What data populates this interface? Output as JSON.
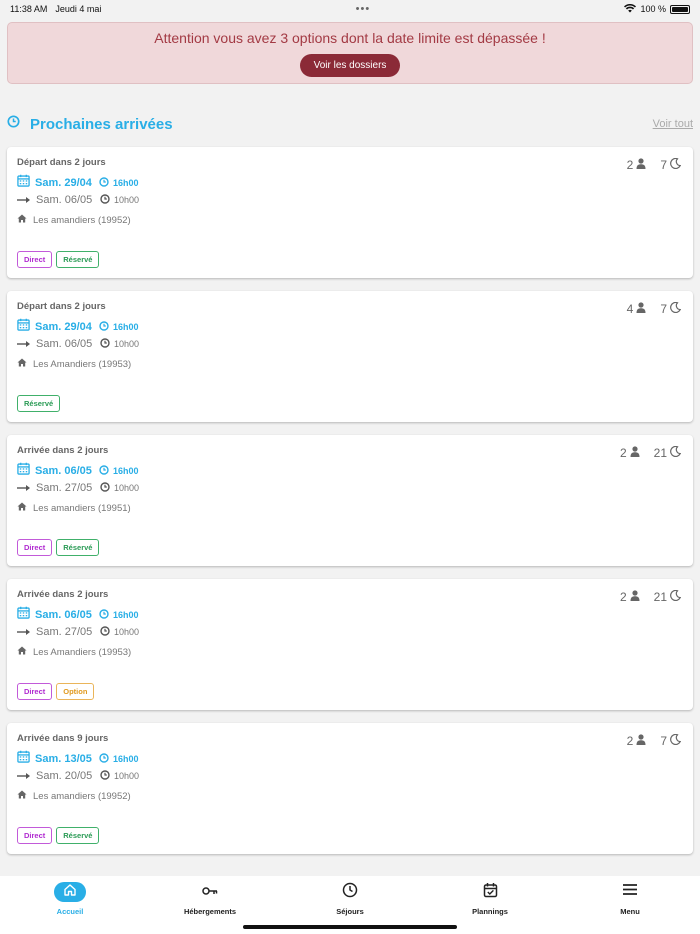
{
  "status": {
    "time": "11:38 AM",
    "date": "Jeudi 4 mai",
    "battery": "100 %",
    "dots": "•••"
  },
  "alert": {
    "message": "Attention vous avez 3 options dont la date limite est dépassée !",
    "button_label": "Voir les dossiers"
  },
  "section": {
    "title": "Prochaines arrivées",
    "see_all": "Voir tout"
  },
  "colors": {
    "accent": "#29aee6",
    "alert_bg": "#f0d8da",
    "alert_text": "#a33a44",
    "alert_button": "#8b2a37",
    "tag_direct": "#b02ad0",
    "tag_reserve": "#2a9b55",
    "tag_option": "#e09a20"
  },
  "cards": [
    {
      "heading": "Départ dans 2 jours",
      "guests": "2",
      "nights": "7",
      "start_date": "Sam. 29/04",
      "start_time": "16h00",
      "end_date": "Sam. 06/05",
      "end_time": "10h00",
      "lodging": "Les amandiers (19952)",
      "tags": [
        "Direct",
        "Réservé"
      ]
    },
    {
      "heading": "Départ dans 2 jours",
      "guests": "4",
      "nights": "7",
      "start_date": "Sam. 29/04",
      "start_time": "16h00",
      "end_date": "Sam. 06/05",
      "end_time": "10h00",
      "lodging": "Les Amandiers (19953)",
      "tags": [
        "Réservé"
      ]
    },
    {
      "heading": "Arrivée dans 2 jours",
      "guests": "2",
      "nights": "21",
      "start_date": "Sam. 06/05",
      "start_time": "16h00",
      "end_date": "Sam. 27/05",
      "end_time": "10h00",
      "lodging": "Les amandiers (19951)",
      "tags": [
        "Direct",
        "Réservé"
      ]
    },
    {
      "heading": "Arrivée dans 2 jours",
      "guests": "2",
      "nights": "21",
      "start_date": "Sam. 06/05",
      "start_time": "16h00",
      "end_date": "Sam. 27/05",
      "end_time": "10h00",
      "lodging": "Les Amandiers (19953)",
      "tags": [
        "Direct",
        "Option"
      ]
    },
    {
      "heading": "Arrivée dans 9 jours",
      "guests": "2",
      "nights": "7",
      "start_date": "Sam. 13/05",
      "start_time": "16h00",
      "end_date": "Sam. 20/05",
      "end_time": "10h00",
      "lodging": "Les amandiers (19952)",
      "tags": [
        "Direct",
        "Réservé"
      ]
    }
  ],
  "tabs": [
    {
      "label": "Accueil",
      "icon": "home-icon"
    },
    {
      "label": "Hébergements",
      "icon": "key-icon"
    },
    {
      "label": "Séjours",
      "icon": "clock-icon"
    },
    {
      "label": "Plannings",
      "icon": "calendar-check-icon"
    },
    {
      "label": "Menu",
      "icon": "menu-icon"
    }
  ]
}
